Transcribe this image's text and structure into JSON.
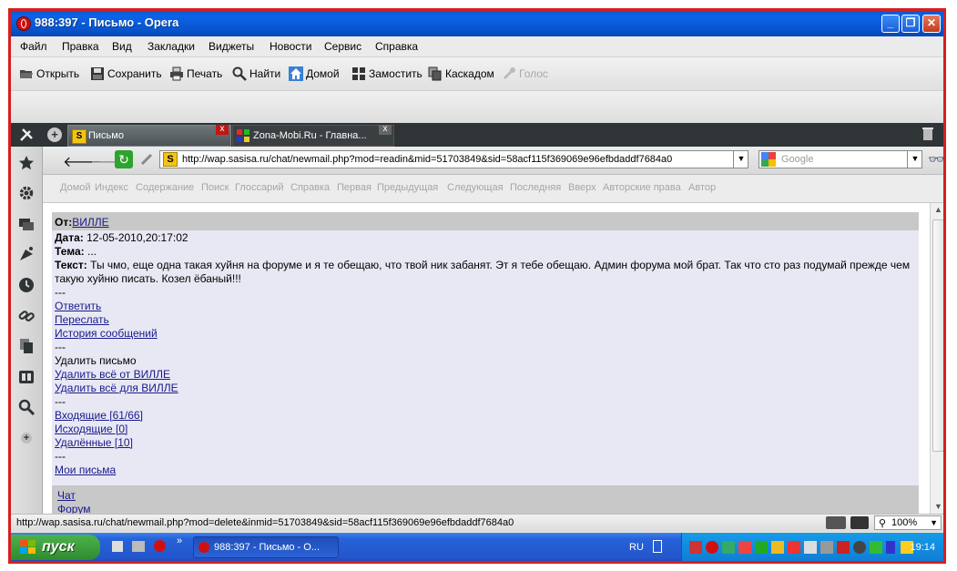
{
  "window": {
    "title": "988:397 - Письмо - Opera"
  },
  "menu": [
    "Файл",
    "Правка",
    "Вид",
    "Закладки",
    "Виджеты",
    "Новости",
    "Сервис",
    "Справка"
  ],
  "toolbar": {
    "open": "Открыть",
    "save": "Сохранить",
    "print": "Печать",
    "find": "Найти",
    "home": "Домой",
    "tile": "Замостить",
    "cascade": "Каскадом",
    "voice": "Голос"
  },
  "tabs": [
    {
      "label": "Письмо",
      "close": "x"
    },
    {
      "label": "Zona-Mobi.Ru - Главна...",
      "close": "x"
    }
  ],
  "address": {
    "url": "http://wap.sasisa.ru/chat/newmail.php?mod=readin&mid=51703849&sid=58acf115f369069e96efbdaddf7684a0",
    "search_placeholder": "Google"
  },
  "navlinks": [
    "Домой",
    "Индекс",
    "Содержание",
    "Поиск",
    "Глоссарий",
    "Справка",
    "Первая",
    "Предыдущая",
    "Следующая",
    "Последняя",
    "Вверх",
    "Авторские права",
    "Автор"
  ],
  "message": {
    "from_label": "От:",
    "from_name": "ВИЛЛЕ",
    "date_label": "Дата:",
    "date_value": "12-05-2010,20:17:02",
    "subject_label": "Тема:",
    "subject_value": "...",
    "text_label": "Текст:",
    "text_line1": "Ты чмо, еще одна такая хуйня на форуме и я те обещаю, что твой ник забанят. Эт я тебе обещаю. Админ форума мой брат. Так что сто раз подумай прежде чем",
    "text_line2": "такую хуйню писать. Козел ёбаный!!!",
    "separator": "---",
    "reply": "Ответить",
    "forward": "Переслать",
    "history": "История сообщений",
    "delete": "Удалить письмо",
    "delete_all_from": "Удалить всё от ВИЛЛЕ",
    "delete_all_for": "Удалить всё для ВИЛЛЕ",
    "inbox": "Входящие [61/66]",
    "outbox": "Исходящие [0]",
    "deleted": "Удалённые [10]",
    "my_letters": "Мои письма",
    "chat": "Чат",
    "forum": "Форум"
  },
  "status": {
    "url": "http://wap.sasisa.ru/chat/newmail.php?mod=delete&inmid=51703849&sid=58acf115f369069e96efbdaddf7684a0",
    "zoom": "100%"
  },
  "taskbar": {
    "start": "пуск",
    "task": "988:397 - Письмо - О...",
    "lang": "RU",
    "clock": "19:14"
  },
  "colors": {
    "frame": "#d81e1e",
    "titlebar": "#0b62e8",
    "link": "#1a1a8a",
    "page_bg": "#e8e8f5"
  }
}
